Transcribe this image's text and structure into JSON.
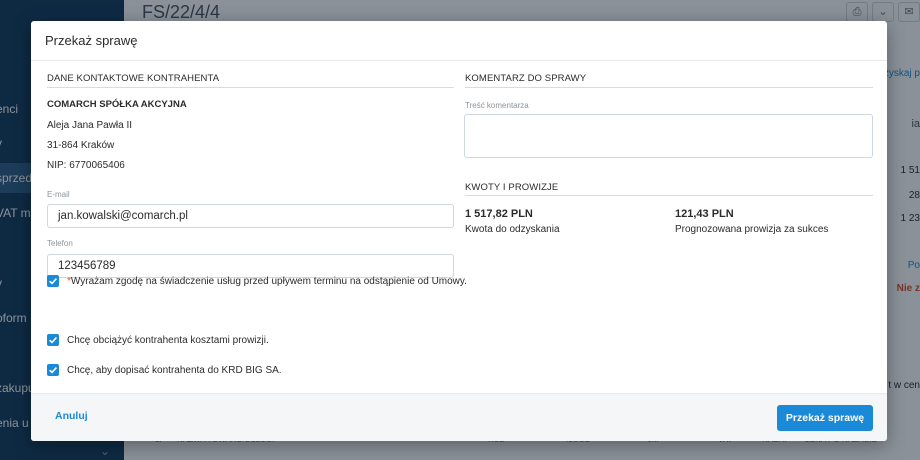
{
  "background": {
    "document_title": "FS/22/4/4",
    "sidebar_fragments": [
      "enci",
      "y",
      "sprzed",
      "VAT ma",
      "i",
      "y",
      "oform",
      "zakupu",
      "enia u c"
    ],
    "right_fragments": [
      "zyskaj p",
      "ia",
      "1 51",
      "28",
      "1 23",
      "Po",
      "Nie z",
      "t w cen"
    ],
    "table_headers": [
      "LP",
      "NAZWA TOWARU/USŁUGI",
      "KOD",
      "ILOŚĆ",
      "JM",
      "VAT",
      "RABAT",
      "CENA PO RABACIE"
    ]
  },
  "modal": {
    "title": "Przekaż sprawę",
    "contact": {
      "heading": "DANE KONTAKTOWE KONTRAHENTA",
      "company": "COMARCH SPÓŁKA AKCYJNA",
      "street": "Aleja Jana Pawła II",
      "city": "31-864 Kraków",
      "nip": "NIP: 6770065406",
      "email_label": "E-mail",
      "email_value": "jan.kowalski@comarch.pl",
      "phone_label": "Telefon",
      "phone_value": "123456789"
    },
    "comment": {
      "heading": "KOMENTARZ DO SPRAWY",
      "field_label": "Treść komentarza"
    },
    "amounts": {
      "heading": "KWOTY I PROWIZJE",
      "amount_value": "1 517,82 PLN",
      "amount_label": "Kwota do odzyskania",
      "commission_value": "121,43 PLN",
      "commission_label": "Prognozowana prowizja za sukces"
    },
    "consents": [
      {
        "required_mark": "*",
        "label": "Wyrażam zgodę na świadczenie usług przed upływem terminu na odstąpienie od Umowy.",
        "checked": true
      },
      {
        "required_mark": "",
        "label": "Chcę obciążyć kontrahenta kosztami prowizji.",
        "checked": true
      },
      {
        "required_mark": "",
        "label": "Chcę, aby dopisać kontrahenta do KRD BIG SA.",
        "checked": true
      }
    ],
    "footer": {
      "cancel_label": "Anuluj",
      "submit_label": "Przekaż sprawę"
    }
  },
  "colors": {
    "accent": "#1a8ad8",
    "sidebar": "#123a5c",
    "required": "#e0502a"
  }
}
